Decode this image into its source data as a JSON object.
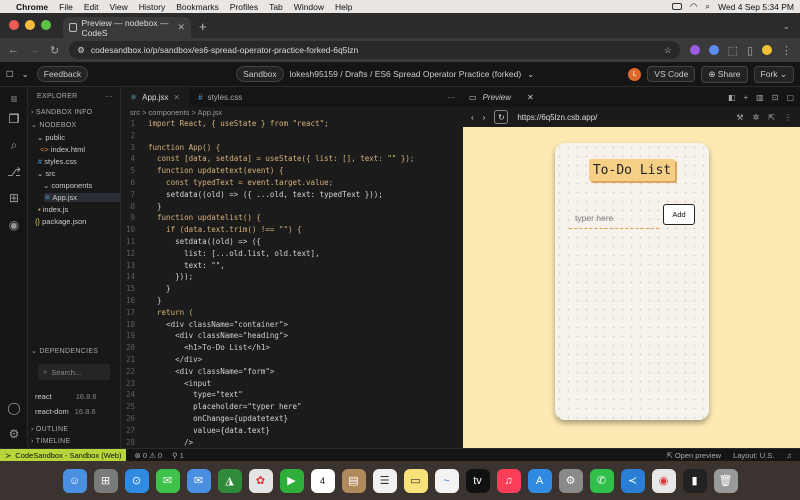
{
  "menubar": {
    "app": "Chrome",
    "items": [
      "File",
      "Edit",
      "View",
      "History",
      "Bookmarks",
      "Profiles",
      "Tab",
      "Window",
      "Help"
    ],
    "clock": "Wed 4 Sep  5:34 PM"
  },
  "browser": {
    "tab_title": "Preview — nodebox — CodeS",
    "new_tab": "+",
    "url": "codesandbox.io/p/sandbox/es6-spread-operator-practice-forked-6q5lzn"
  },
  "topbar": {
    "feedback": "Feedback",
    "sandbox_badge": "Sandbox",
    "breadcrumb": "lokesh95159 / Drafts / ES6 Spread Operator Practice (forked)",
    "avatar_letter": "L",
    "vscode": "VS Code",
    "share": "Share",
    "fork": "Fork"
  },
  "sidebar": {
    "explorer": "EXPLORER",
    "sandbox_info": "SANDBOX INFO",
    "nodebox": "NODEBOX",
    "tree": [
      {
        "label": "public",
        "indent": 1,
        "kind": "folder"
      },
      {
        "label": "index.html",
        "indent": 2,
        "kind": "html"
      },
      {
        "label": "styles.css",
        "indent": 1,
        "kind": "css"
      },
      {
        "label": "src",
        "indent": 1,
        "kind": "folder"
      },
      {
        "label": "components",
        "indent": 2,
        "kind": "folder"
      },
      {
        "label": "App.jsx",
        "indent": 3,
        "kind": "jsx"
      },
      {
        "label": "index.js",
        "indent": 2,
        "kind": "js"
      },
      {
        "label": "package.json",
        "indent": 1,
        "kind": "json"
      }
    ],
    "dependencies": "DEPENDENCIES",
    "search_placeholder": "Search...",
    "deps": [
      {
        "name": "react",
        "version": "16.8.6"
      },
      {
        "name": "react-dom",
        "version": "16.8.6"
      }
    ],
    "outline": "OUTLINE",
    "timeline": "TIMELINE"
  },
  "editor": {
    "tabs": [
      {
        "label": "App.jsx",
        "active": true
      },
      {
        "label": "styles.css",
        "active": false
      }
    ],
    "crumb": "src > components > App.jsx",
    "lines": [
      {
        "n": "1",
        "code": "import React, { useState } from \"react\";"
      },
      {
        "n": "2",
        "code": ""
      },
      {
        "n": "3",
        "code": "function App() {"
      },
      {
        "n": "4",
        "code": "  const [data, setdata] = useState({ list: [], text: \"\" });"
      },
      {
        "n": "5",
        "code": "  function updatetext(event) {"
      },
      {
        "n": "6",
        "code": "    const typedText = event.target.value;"
      },
      {
        "n": "7",
        "code": "    setdata((old) => ({ ...old, text: typedText }));"
      },
      {
        "n": "8",
        "code": "  }"
      },
      {
        "n": "9",
        "code": "  function updatelist() {"
      },
      {
        "n": "10",
        "code": "    if (data.text.trim() !== \"\") {"
      },
      {
        "n": "11",
        "code": "      setdata((old) => ({"
      },
      {
        "n": "12",
        "code": "        list: [...old.list, old.text],"
      },
      {
        "n": "13",
        "code": "        text: \"\","
      },
      {
        "n": "14",
        "code": "      }));"
      },
      {
        "n": "15",
        "code": "    }"
      },
      {
        "n": "16",
        "code": "  }"
      },
      {
        "n": "17",
        "code": "  return ("
      },
      {
        "n": "18",
        "code": "    <div className=\"container\">"
      },
      {
        "n": "19",
        "code": "      <div className=\"heading\">"
      },
      {
        "n": "20",
        "code": "        <h1>To-Do List</h1>"
      },
      {
        "n": "21",
        "code": "      </div>"
      },
      {
        "n": "22",
        "code": "      <div className=\"form\">"
      },
      {
        "n": "23",
        "code": "        <input"
      },
      {
        "n": "24",
        "code": "          type=\"text\""
      },
      {
        "n": "25",
        "code": "          placeholder=\"typer here\""
      },
      {
        "n": "26",
        "code": "          onChange={updatetext}"
      },
      {
        "n": "27",
        "code": "          value={data.text}"
      },
      {
        "n": "28",
        "code": "        />"
      }
    ]
  },
  "preview": {
    "title": "Preview",
    "url": "https://6q5lzn.csb.app/",
    "heading": "To-Do List",
    "input_placeholder": "typer here",
    "add": "Add"
  },
  "status": {
    "env": "CodeSandbox - Sandbox (Web)",
    "problems": "0 ⚠ 0",
    "ports": "1",
    "open_preview": "Open preview",
    "layout": "Layout: U.S."
  },
  "colors": {
    "preview_bg": "#fde9b2",
    "status_env": "#b8d63b",
    "title_bg": "#f6cf86"
  }
}
